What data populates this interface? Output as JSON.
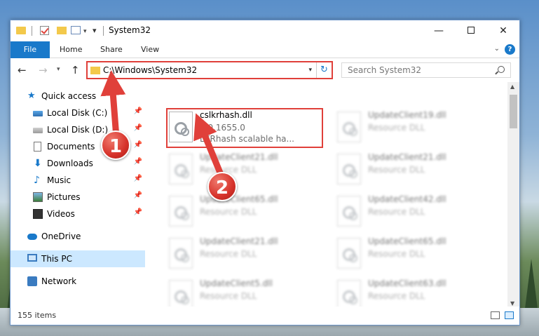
{
  "window": {
    "title": "System32",
    "minimize_glyph": "—",
    "close_glyph": "✕"
  },
  "quick_access_toolbar": {
    "dropdown_glyph": "▾",
    "customize_glyph": "▾"
  },
  "ribbon": {
    "tabs": [
      "File",
      "Home",
      "Share",
      "View"
    ],
    "collapse_glyph": "⌄",
    "help_glyph": "?"
  },
  "navigation": {
    "back_glyph": "←",
    "forward_glyph": "→",
    "recent_glyph": "▾",
    "up_glyph": "↑",
    "address": "C:\\Windows\\System32",
    "address_dropdown_glyph": "▾",
    "refresh_glyph": "↻",
    "search_placeholder": "Search System32"
  },
  "sidebar": {
    "items": [
      {
        "label": "Quick access",
        "icon": "star-icon",
        "pinned": false
      },
      {
        "label": "Local Disk (C:)",
        "icon": "drive-icon",
        "pinned": true
      },
      {
        "label": "Local Disk (D:)",
        "icon": "drive-icon",
        "pinned": true
      },
      {
        "label": "Documents",
        "icon": "documents-icon",
        "pinned": true
      },
      {
        "label": "Downloads",
        "icon": "download-icon",
        "pinned": true
      },
      {
        "label": "Music",
        "icon": "music-icon",
        "pinned": true
      },
      {
        "label": "Pictures",
        "icon": "pictures-icon",
        "pinned": true
      },
      {
        "label": "Videos",
        "icon": "videos-icon",
        "pinned": true
      },
      {
        "label": "OneDrive",
        "icon": "onedrive-icon",
        "pinned": false
      },
      {
        "label": "This PC",
        "icon": "this-pc-icon",
        "pinned": false,
        "selected": true
      },
      {
        "label": "Network",
        "icon": "network-icon",
        "pinned": false
      }
    ],
    "pin_glyph": "📌"
  },
  "files": [
    {
      "name": "cslkrhash.dll",
      "line2": "4.0.1655.0",
      "line3": "LKRhash scalable ha...",
      "highlighted": true
    },
    {
      "name": "UpdateClient19.dll",
      "line2": "Resource DLL",
      "blurred": true
    },
    {
      "name": "UpdateClient21.dll",
      "line2": "Resource DLL",
      "blurred": true
    },
    {
      "name": "UpdateClient21.dll",
      "line2": "Resource DLL",
      "blurred": true
    },
    {
      "name": "UpdateClient65.dll",
      "line2": "Resource DLL",
      "blurred": true
    },
    {
      "name": "UpdateClient42.dll",
      "line2": "Resource DLL",
      "blurred": true
    },
    {
      "name": "UpdateClient21.dll",
      "line2": "Resource DLL",
      "blurred": true
    },
    {
      "name": "UpdateClient65.dll",
      "line2": "Resource DLL",
      "blurred": true
    },
    {
      "name": "UpdateClient5.dll",
      "line2": "Resource DLL",
      "blurred": true
    },
    {
      "name": "UpdateClient63.dll",
      "line2": "Resource DLL",
      "blurred": true
    }
  ],
  "scrollbar": {
    "up_glyph": "▲",
    "down_glyph": "▼"
  },
  "status": {
    "item_count": "155 items"
  },
  "annotations": {
    "step1": "1",
    "step2": "2",
    "color": "#e0403a"
  },
  "colors": {
    "accent": "#1979ca",
    "highlight_border": "#e0403a",
    "selected_bg": "#cce8ff"
  }
}
